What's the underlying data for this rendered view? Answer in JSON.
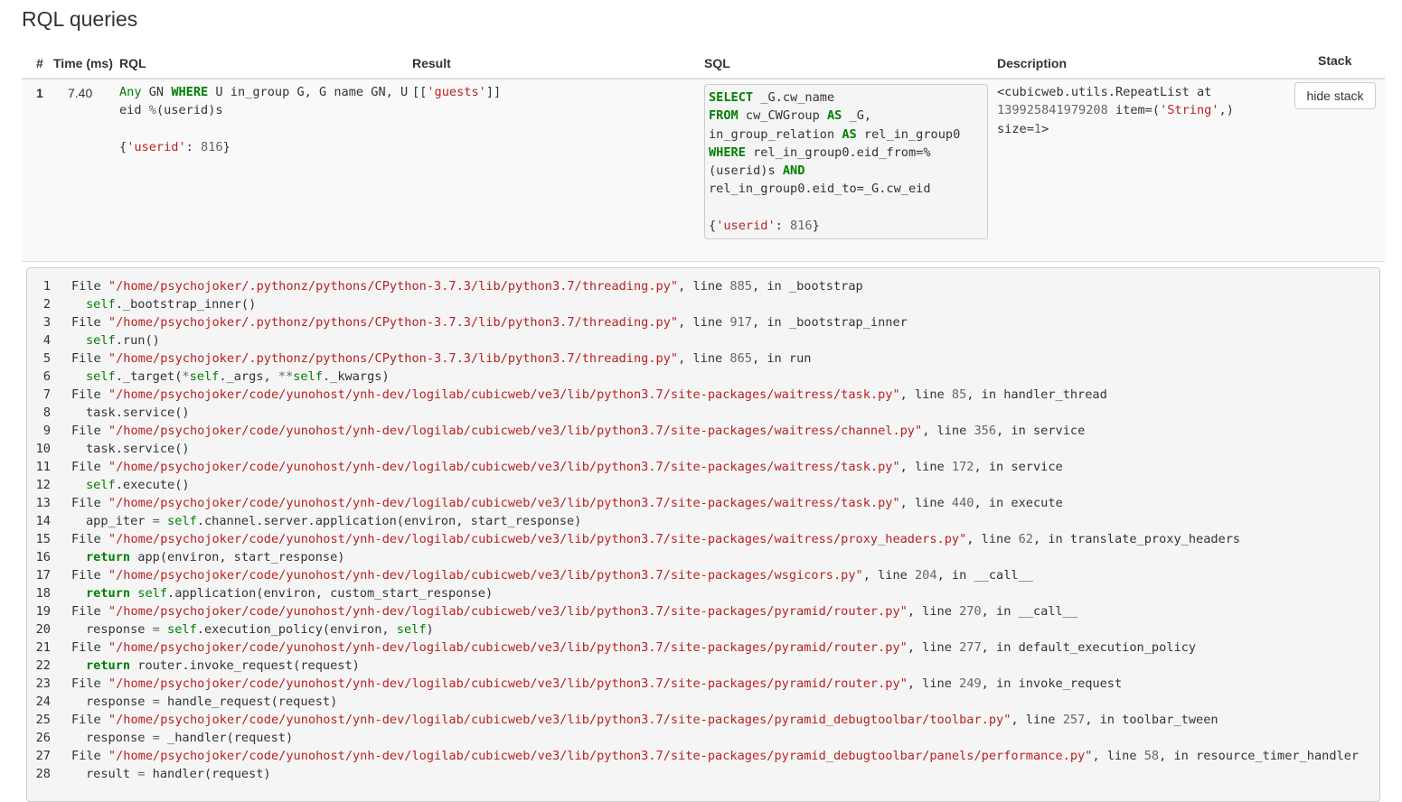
{
  "page_title": "RQL queries",
  "headers": {
    "num": "#",
    "time": "Time (ms)",
    "rql": "RQL",
    "result": "Result",
    "sql": "SQL",
    "description": "Description",
    "stack": "Stack"
  },
  "row": {
    "index": "1",
    "time": "7.40",
    "rql": {
      "kw_any": "Any",
      "text1": " GN ",
      "kw_where": "WHERE",
      "text2": " U in_group G, G name GN, U",
      "line2a": "eid ",
      "line2op": "%",
      "line2b": "(userid)s",
      "arg_open": "{",
      "arg_key": "'userid'",
      "arg_colon": ": ",
      "arg_val": "816",
      "arg_close": "}"
    },
    "result": {
      "open": "[[",
      "value": "'guests'",
      "close": "]]"
    },
    "sql": {
      "kw_select": "SELECT",
      "l1": " _G.cw_name",
      "kw_from": "FROM",
      "l2": " cw_CWGroup ",
      "kw_as1": "AS",
      "l2b": " _G,",
      "l3": "in_group_relation ",
      "kw_as2": "AS",
      "l3b": " rel_in_group0",
      "kw_where": "WHERE",
      "l4": " rel_in_group0.eid_from=%",
      "l5": "(userid)s ",
      "kw_and": "AND",
      "l6": "rel_in_group0.eid_to=_G.cw_eid",
      "arg_open": "{",
      "arg_key": "'userid'",
      "arg_colon": ": ",
      "arg_val": "816",
      "arg_close": "}"
    },
    "description": {
      "p1": "<cubicweb.utils.RepeatList at",
      "p2num": "139925841979208",
      "p2a": " item=(",
      "p2str": "'String'",
      "p2b": ",)",
      "p3a": "size=",
      "p3num": "1",
      "p3b": ">"
    },
    "hide_stack_label": "hide stack"
  },
  "stack": [
    {
      "n": "1",
      "kind": "file",
      "path": "\"/home/psychojoker/.pythonz/pythons/CPython-3.7.3/lib/python3.7/threading.py\"",
      "line": "885",
      "func": "_bootstrap"
    },
    {
      "n": "2",
      "kind": "code",
      "parts": [
        [
          "self",
          "self"
        ],
        [
          "t",
          "._bootstrap_inner()"
        ]
      ]
    },
    {
      "n": "3",
      "kind": "file",
      "path": "\"/home/psychojoker/.pythonz/pythons/CPython-3.7.3/lib/python3.7/threading.py\"",
      "line": "917",
      "func": "_bootstrap_inner"
    },
    {
      "n": "4",
      "kind": "code",
      "parts": [
        [
          "self",
          "self"
        ],
        [
          "t",
          ".run()"
        ]
      ]
    },
    {
      "n": "5",
      "kind": "file",
      "path": "\"/home/psychojoker/.pythonz/pythons/CPython-3.7.3/lib/python3.7/threading.py\"",
      "line": "865",
      "func": "run"
    },
    {
      "n": "6",
      "kind": "code",
      "parts": [
        [
          "self",
          "self"
        ],
        [
          "t",
          "._target("
        ],
        [
          "op",
          "*"
        ],
        [
          "self",
          "self"
        ],
        [
          "t",
          "._args, "
        ],
        [
          "op",
          "**"
        ],
        [
          "self",
          "self"
        ],
        [
          "t",
          "._kwargs)"
        ]
      ]
    },
    {
      "n": "7",
      "kind": "file",
      "path": "\"/home/psychojoker/code/yunohost/ynh-dev/logilab/cubicweb/ve3/lib/python3.7/site-packages/waitress/task.py\"",
      "line": "85",
      "func": "handler_thread"
    },
    {
      "n": "8",
      "kind": "code",
      "parts": [
        [
          "t",
          "task.service()"
        ]
      ]
    },
    {
      "n": "9",
      "kind": "file",
      "path": "\"/home/psychojoker/code/yunohost/ynh-dev/logilab/cubicweb/ve3/lib/python3.7/site-packages/waitress/channel.py\"",
      "line": "356",
      "func": "service"
    },
    {
      "n": "10",
      "kind": "code",
      "parts": [
        [
          "t",
          "task.service()"
        ]
      ]
    },
    {
      "n": "11",
      "kind": "file",
      "path": "\"/home/psychojoker/code/yunohost/ynh-dev/logilab/cubicweb/ve3/lib/python3.7/site-packages/waitress/task.py\"",
      "line": "172",
      "func": "service"
    },
    {
      "n": "12",
      "kind": "code",
      "parts": [
        [
          "self",
          "self"
        ],
        [
          "t",
          ".execute()"
        ]
      ]
    },
    {
      "n": "13",
      "kind": "file",
      "path": "\"/home/psychojoker/code/yunohost/ynh-dev/logilab/cubicweb/ve3/lib/python3.7/site-packages/waitress/task.py\"",
      "line": "440",
      "func": "execute"
    },
    {
      "n": "14",
      "kind": "code",
      "parts": [
        [
          "t",
          "app_iter "
        ],
        [
          "op",
          "="
        ],
        [
          "t",
          " "
        ],
        [
          "self",
          "self"
        ],
        [
          "t",
          ".channel.server.application(environ, start_response)"
        ]
      ]
    },
    {
      "n": "15",
      "kind": "file",
      "path": "\"/home/psychojoker/code/yunohost/ynh-dev/logilab/cubicweb/ve3/lib/python3.7/site-packages/waitress/proxy_headers.py\"",
      "line": "62",
      "func": "translate_proxy_headers"
    },
    {
      "n": "16",
      "kind": "code",
      "parts": [
        [
          "kw",
          "return"
        ],
        [
          "t",
          " app(environ, start_response)"
        ]
      ]
    },
    {
      "n": "17",
      "kind": "file",
      "path": "\"/home/psychojoker/code/yunohost/ynh-dev/logilab/cubicweb/ve3/lib/python3.7/site-packages/wsgicors.py\"",
      "line": "204",
      "func": "__call__"
    },
    {
      "n": "18",
      "kind": "code",
      "parts": [
        [
          "kw",
          "return"
        ],
        [
          "t",
          " "
        ],
        [
          "self",
          "self"
        ],
        [
          "t",
          ".application(environ, custom_start_response)"
        ]
      ]
    },
    {
      "n": "19",
      "kind": "file",
      "path": "\"/home/psychojoker/code/yunohost/ynh-dev/logilab/cubicweb/ve3/lib/python3.7/site-packages/pyramid/router.py\"",
      "line": "270",
      "func": "__call__"
    },
    {
      "n": "20",
      "kind": "code",
      "parts": [
        [
          "t",
          "response "
        ],
        [
          "op",
          "="
        ],
        [
          "t",
          " "
        ],
        [
          "self",
          "self"
        ],
        [
          "t",
          ".execution_policy(environ, "
        ],
        [
          "self",
          "self"
        ],
        [
          "t",
          ")"
        ]
      ]
    },
    {
      "n": "21",
      "kind": "file",
      "path": "\"/home/psychojoker/code/yunohost/ynh-dev/logilab/cubicweb/ve3/lib/python3.7/site-packages/pyramid/router.py\"",
      "line": "277",
      "func": "default_execution_policy"
    },
    {
      "n": "22",
      "kind": "code",
      "parts": [
        [
          "kw",
          "return"
        ],
        [
          "t",
          " router.invoke_request(request)"
        ]
      ]
    },
    {
      "n": "23",
      "kind": "file",
      "path": "\"/home/psychojoker/code/yunohost/ynh-dev/logilab/cubicweb/ve3/lib/python3.7/site-packages/pyramid/router.py\"",
      "line": "249",
      "func": "invoke_request"
    },
    {
      "n": "24",
      "kind": "code",
      "parts": [
        [
          "t",
          "response "
        ],
        [
          "op",
          "="
        ],
        [
          "t",
          " handle_request(request)"
        ]
      ]
    },
    {
      "n": "25",
      "kind": "file",
      "path": "\"/home/psychojoker/code/yunohost/ynh-dev/logilab/cubicweb/ve3/lib/python3.7/site-packages/pyramid_debugtoolbar/toolbar.py\"",
      "line": "257",
      "func": "toolbar_tween"
    },
    {
      "n": "26",
      "kind": "code",
      "parts": [
        [
          "t",
          "response "
        ],
        [
          "op",
          "="
        ],
        [
          "t",
          " _handler(request)"
        ]
      ]
    },
    {
      "n": "27",
      "kind": "file",
      "path": "\"/home/psychojoker/code/yunohost/ynh-dev/logilab/cubicweb/ve3/lib/python3.7/site-packages/pyramid_debugtoolbar/panels/performance.py\"",
      "line": "58",
      "func": "resource_timer_handler"
    },
    {
      "n": "28",
      "kind": "code",
      "parts": [
        [
          "t",
          "result "
        ],
        [
          "op",
          "="
        ],
        [
          "t",
          " handler(request)"
        ]
      ]
    }
  ],
  "stack_tokens": {
    "file": "File ",
    "line": ", line ",
    "in": ", in "
  }
}
